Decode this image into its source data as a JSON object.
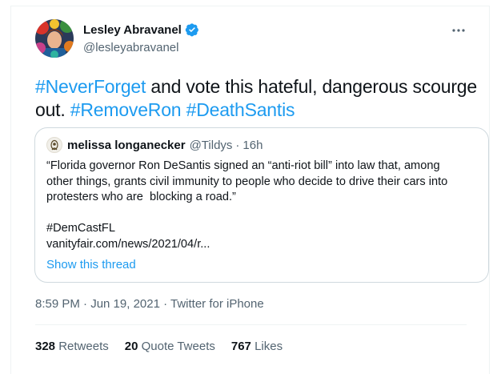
{
  "author": {
    "name": "Lesley Abravanel",
    "handle": "@lesleyabravanel",
    "verified_color": "#1d9bf0"
  },
  "tweet": {
    "parts": [
      {
        "text": "#NeverForget",
        "type": "hashtag"
      },
      {
        "text": " and vote this hateful, dangerous scourge out. ",
        "type": "text"
      },
      {
        "text": "#RemoveRon",
        "type": "hashtag"
      },
      {
        "text": " ",
        "type": "text"
      },
      {
        "text": "#DeathSantis",
        "type": "hashtag"
      }
    ]
  },
  "quote": {
    "name": "melissa longanecker",
    "handle": "@Tildys",
    "separator": "·",
    "time": "16h",
    "lines": [
      "“Florida governor Ron DeSantis signed an “anti-riot bill” into law that, among",
      "other things, grants civil immunity to people who decide to drive their cars into",
      "protesters who are  blocking a road.”"
    ],
    "hashtag_line": "#DemCastFL",
    "link": "vanityfair.com/news/2021/04/r...",
    "show_thread": "Show this thread"
  },
  "meta": {
    "timestamp": "8:59 PM · Jun 19, 2021 · Twitter for iPhone"
  },
  "stats": [
    {
      "count": "328",
      "label": "Retweets"
    },
    {
      "count": "20",
      "label": "Quote Tweets"
    },
    {
      "count": "767",
      "label": "Likes"
    }
  ],
  "colors": {
    "accent": "#1d9bf0",
    "text": "#0f1419",
    "secondary": "#536471",
    "border": "#cfd9de"
  },
  "icons": {
    "more": "more-horizontal-icon",
    "verified": "verified-badge-icon"
  }
}
